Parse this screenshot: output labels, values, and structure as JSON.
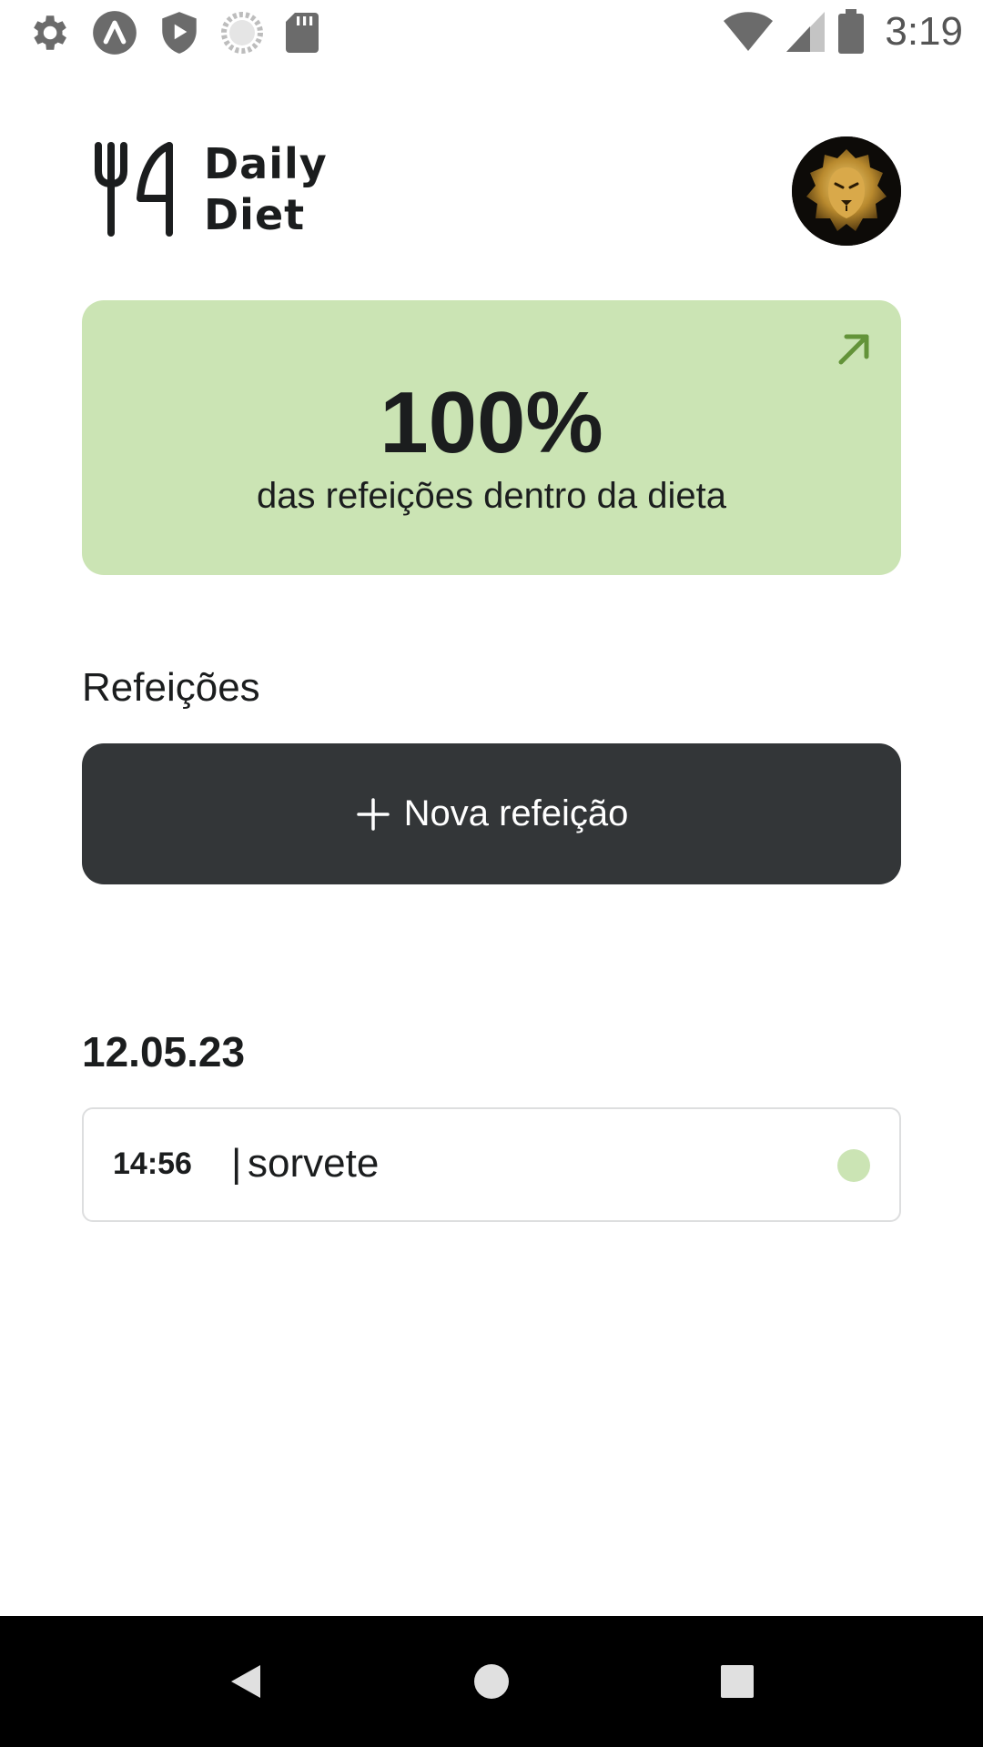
{
  "status_bar": {
    "time": "3:19",
    "icons_left": [
      "gear-icon",
      "app-notification-icon",
      "shield-play-icon",
      "loading-circle-icon",
      "sd-card-icon"
    ],
    "icons_right": [
      "wifi-icon",
      "cell-signal-icon",
      "battery-icon"
    ]
  },
  "header": {
    "logo_line1": "Daily",
    "logo_line2": "Diet",
    "logo_icon": "fork-knife-icon",
    "avatar_icon": "lion-avatar"
  },
  "summary": {
    "percent": "100%",
    "caption": "das refeições dentro da dieta",
    "open_icon": "arrow-up-right-icon",
    "color": "#CBE4B4",
    "accent": "#639339"
  },
  "meals": {
    "section_title": "Refeições",
    "new_button_label": "Nova refeição",
    "new_button_icon": "plus-icon",
    "button_color": "#333638",
    "days": [
      {
        "date": "12.05.23",
        "items": [
          {
            "time": "14:56",
            "separator": "|",
            "name": "sorvete",
            "in_diet": true,
            "status_color": "#CBE4B4"
          }
        ]
      }
    ]
  },
  "nav_bar": {
    "buttons": [
      "back-icon",
      "home-icon",
      "recents-icon"
    ]
  }
}
